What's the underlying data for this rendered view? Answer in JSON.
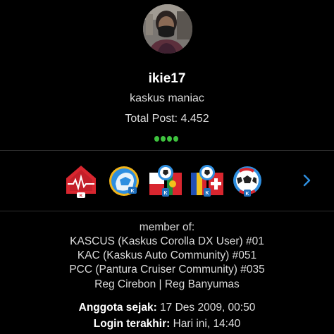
{
  "profile": {
    "username": "ikie17",
    "rank": "kaskus maniac",
    "total_post": "Total Post: 4.452",
    "reputation_dots": 4
  },
  "badges": [
    {
      "name": "heartbeat-badge-icon"
    },
    {
      "name": "kaskus-hand-badge-icon"
    },
    {
      "name": "soccer-portugal-badge-icon"
    },
    {
      "name": "soccer-swiss-badge-icon"
    },
    {
      "name": "soccer-ball-badge-icon"
    }
  ],
  "member_of": {
    "label": "member of:",
    "communities": [
      "KASCUS (Kaskus Corolla DX User) #01",
      "KAC (Kaskus Auto Community) #051",
      "PCC (Pantura Cruiser Community) #035",
      "Reg Cirebon | Reg Banyumas"
    ]
  },
  "joined": {
    "label": "Anggota sejak:",
    "value": "17 Des 2009, 00:50"
  },
  "last_login": {
    "label": "Login terakhir:",
    "value": "Hari ini, 14:40"
  },
  "colors": {
    "background": "#000000",
    "reputation_green": "#3ec33e",
    "accent_blue": "#2f8fe0"
  }
}
